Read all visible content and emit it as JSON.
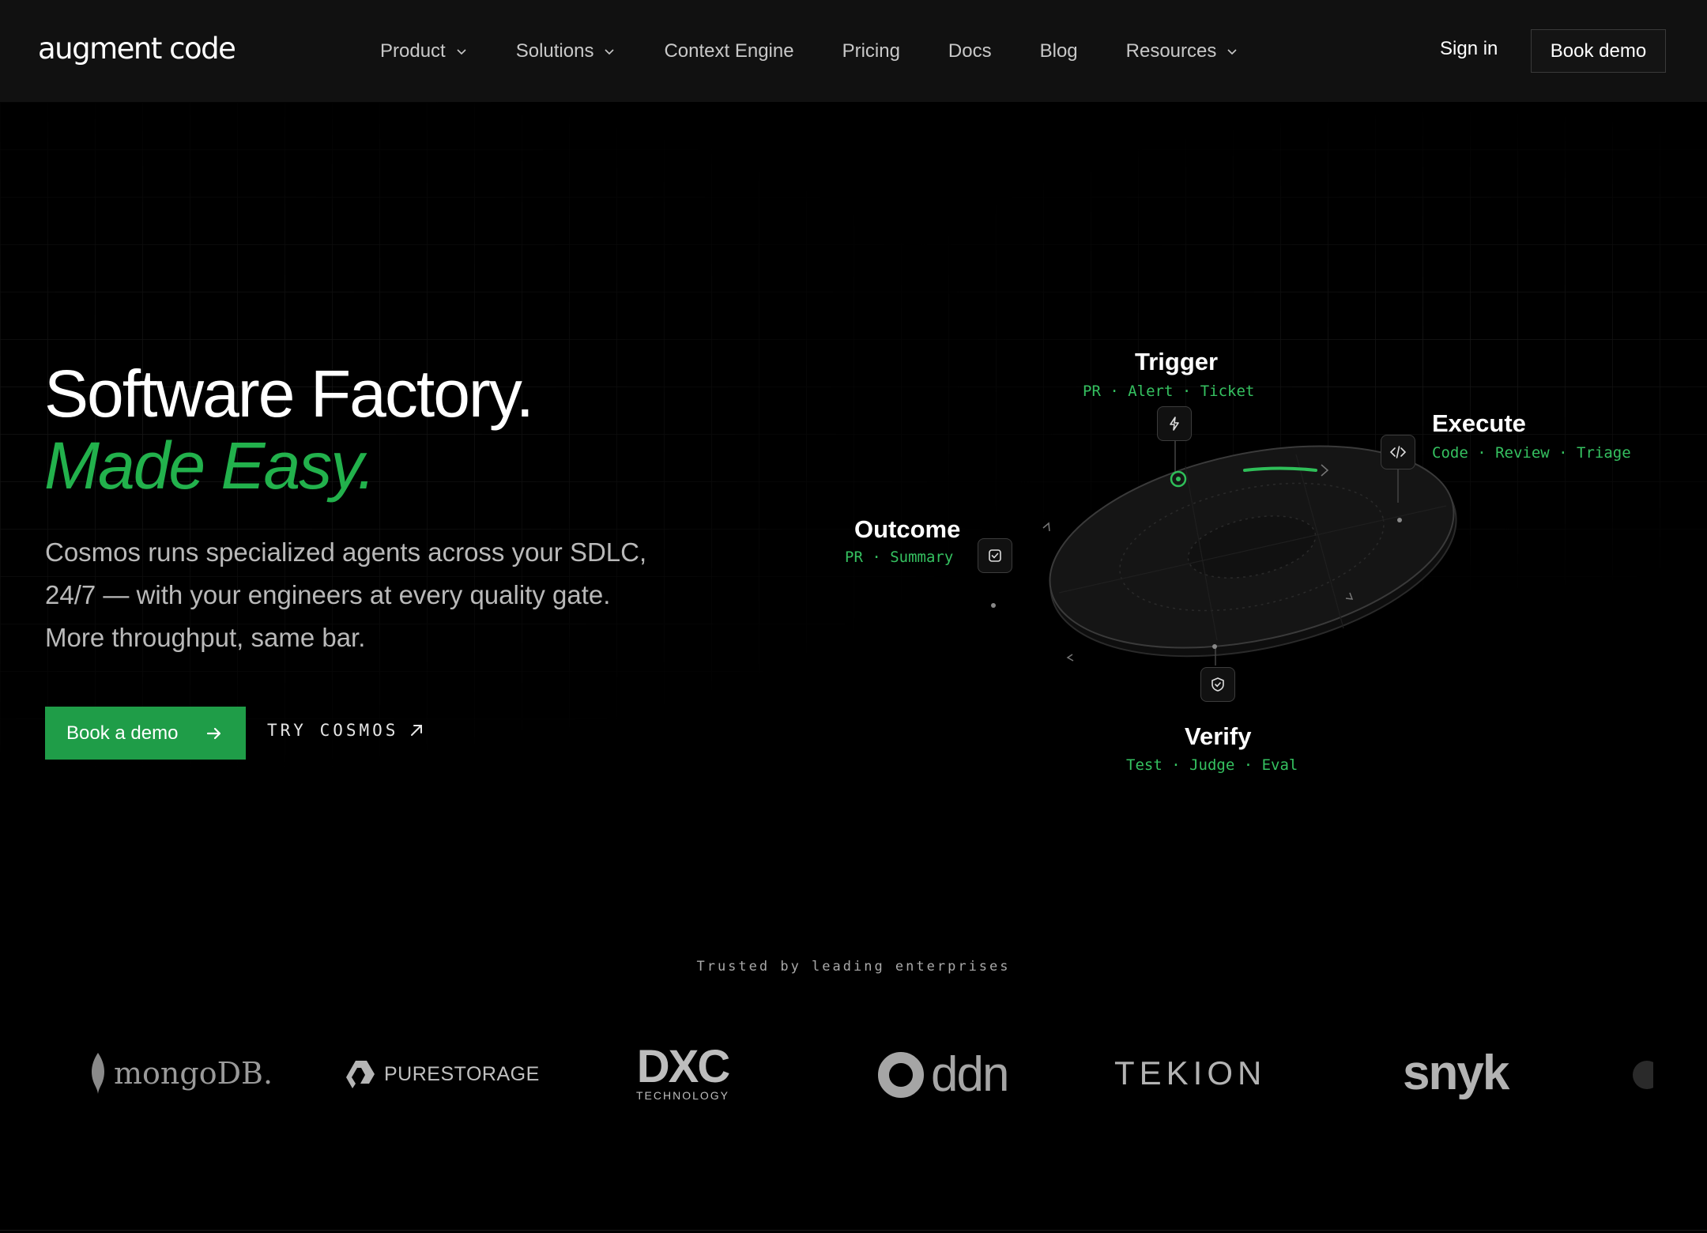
{
  "header": {
    "logo_text": "augment code",
    "nav": [
      {
        "label": "Product",
        "has_dropdown": true
      },
      {
        "label": "Solutions",
        "has_dropdown": true
      },
      {
        "label": "Context Engine",
        "has_dropdown": false
      },
      {
        "label": "Pricing",
        "has_dropdown": false
      },
      {
        "label": "Docs",
        "has_dropdown": false
      },
      {
        "label": "Blog",
        "has_dropdown": false
      },
      {
        "label": "Resources",
        "has_dropdown": true
      }
    ],
    "sign_in": "Sign in",
    "book_demo": "Book demo"
  },
  "hero": {
    "title": "Software Factory.",
    "subtitle": "Made Easy.",
    "description": [
      "Cosmos runs specialized agents across your SDLC,",
      "24/7 — with your engineers at every quality gate.",
      "More throughput, same bar."
    ],
    "cta_primary": "Book a demo",
    "cta_secondary": "TRY COSMOS"
  },
  "diagram": {
    "nodes": {
      "trigger": {
        "title": "Trigger",
        "tags": "PR · Alert · Ticket",
        "icon": "lightning-icon"
      },
      "execute": {
        "title": "Execute",
        "tags": "Code · Review · Triage",
        "icon": "code-icon"
      },
      "outcome": {
        "title": "Outcome",
        "tags": "PR · Summary",
        "icon": "check-square-icon"
      },
      "verify": {
        "title": "Verify",
        "tags": "Test · Judge · Eval",
        "icon": "shield-check-icon"
      }
    }
  },
  "trusted": {
    "label": "Trusted by leading enterprises",
    "logos": [
      {
        "name": "mongoDB."
      },
      {
        "name": "PURESTORAGE"
      },
      {
        "name": "DXC",
        "sub": "TECHNOLOGY"
      },
      {
        "name": "ddn"
      },
      {
        "name": "TEKION"
      },
      {
        "name": "snyk"
      }
    ]
  },
  "colors": {
    "accent": "#22b14c",
    "accent_tags": "#35c160",
    "background": "#000000",
    "header_bg": "#111111"
  }
}
